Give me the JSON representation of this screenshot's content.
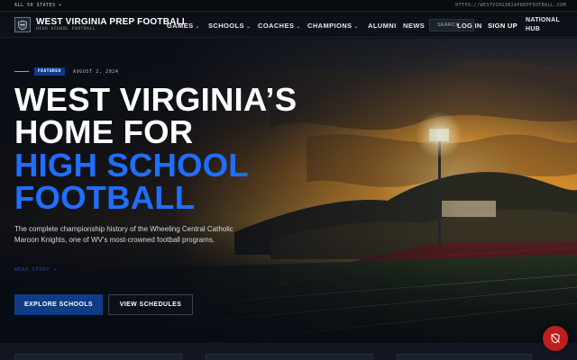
{
  "topbar": {
    "states_label": "ALL 50 STATES ▾",
    "url": "HTTPS://WESTVIRGINIAPREPFOOTBALL.COM"
  },
  "nav": {
    "brand": "WEST VIRGINIA PREP FOOTBALL",
    "brand_sub": "HIGH SCHOOL FOOTBALL",
    "links": [
      {
        "label": "GAMES",
        "dropdown": true
      },
      {
        "label": "SCHOOLS",
        "dropdown": true
      },
      {
        "label": "COACHES",
        "dropdown": true
      },
      {
        "label": "CHAMPIONS",
        "dropdown": true
      },
      {
        "label": "ALUMNI",
        "dropdown": false
      },
      {
        "label": "NEWS",
        "dropdown": false
      }
    ],
    "search_placeholder": "SEARCH",
    "login": "LOG IN",
    "signup": "SIGN UP",
    "hub_line1": "NATIONAL",
    "hub_line2": "HUB"
  },
  "hero": {
    "badge": "FEATURED",
    "date": "AUGUST 2, 2024",
    "title_white": [
      "WEST VIRGINIA’S",
      "HOME FOR"
    ],
    "title_blue": [
      "HIGH SCHOOL",
      "FOOTBALL"
    ],
    "description": "The complete championship history of the Wheeling Central Catholic Maroon Knights, one of WV's most-crowned football programs.",
    "read_story": "READ STORY →",
    "primary_button": "EXPLORE SCHOOLS",
    "secondary_button": "VIEW SCHEDULES"
  },
  "colors": {
    "accent_blue": "#1e6fff",
    "button_blue": "#0e3d86",
    "badge_blue": "#0f3b8c",
    "eyebrow_gold": "#d4a017",
    "fab_red": "#c01d1d"
  },
  "icons": {
    "logo": "shield-logo-icon",
    "fab": "shield-off-icon"
  }
}
